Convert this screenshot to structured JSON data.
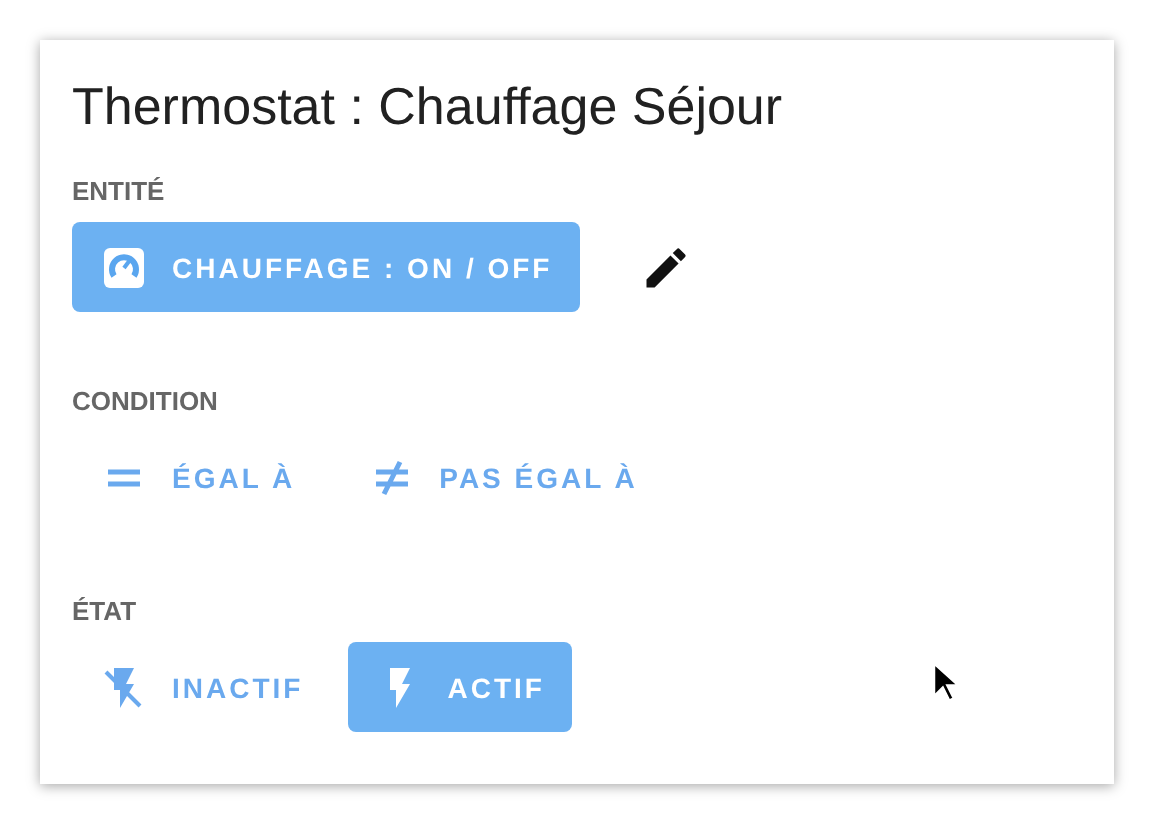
{
  "title": "Thermostat : Chauffage Séjour",
  "entity": {
    "label": "ENTITÉ",
    "button": "CHAUFFAGE : ON / OFF"
  },
  "condition": {
    "label": "CONDITION",
    "options": [
      {
        "kind": "equal",
        "label": "ÉGAL À",
        "selected": false
      },
      {
        "kind": "notequal",
        "label": "PAS ÉGAL À",
        "selected": false
      }
    ]
  },
  "state": {
    "label": "ÉTAT",
    "options": [
      {
        "kind": "off",
        "label": "INACTIF",
        "selected": false
      },
      {
        "kind": "on",
        "label": "ACTIF",
        "selected": true
      }
    ]
  }
}
